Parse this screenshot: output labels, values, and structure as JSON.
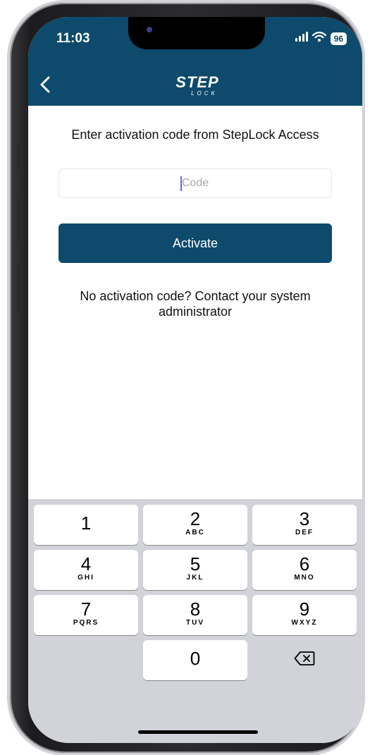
{
  "status_bar": {
    "time": "11:03",
    "battery": "96",
    "signal_icon": "cellular-signal-icon",
    "wifi_icon": "wifi-icon"
  },
  "nav": {
    "back_icon": "chevron-left-icon",
    "logo_main": "STEP",
    "logo_sub": "LOCK"
  },
  "activation": {
    "prompt": "Enter activation code from StepLock Access",
    "code_placeholder": "Code",
    "code_value": "",
    "activate_label": "Activate",
    "no_code_text": "No activation code? Contact your system administrator"
  },
  "keypad": {
    "keys": [
      {
        "digit": "1",
        "letters": ""
      },
      {
        "digit": "2",
        "letters": "ABC"
      },
      {
        "digit": "3",
        "letters": "DEF"
      },
      {
        "digit": "4",
        "letters": "GHI"
      },
      {
        "digit": "5",
        "letters": "JKL"
      },
      {
        "digit": "6",
        "letters": "MNO"
      },
      {
        "digit": "7",
        "letters": "PQRS"
      },
      {
        "digit": "8",
        "letters": "TUV"
      },
      {
        "digit": "9",
        "letters": "WXYZ"
      },
      {
        "digit": "0",
        "letters": ""
      }
    ],
    "delete_icon": "backspace-icon"
  },
  "colors": {
    "brand": "#0d4a6b",
    "keypad_bg": "#d1d3d9",
    "cursor": "#5b6ee0"
  }
}
